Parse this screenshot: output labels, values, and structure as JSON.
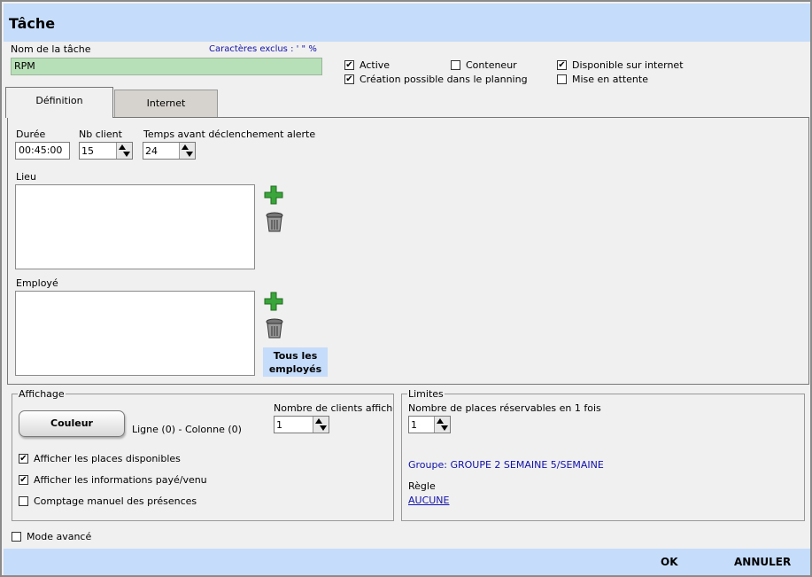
{
  "window": {
    "title": "Tâche"
  },
  "task_name": {
    "label": "Nom de la tâche",
    "excluded_chars_note": "Caractères exclus : ' \" %",
    "value": "RPM"
  },
  "options": {
    "active": {
      "label": "Active",
      "checked": true
    },
    "conteneur": {
      "label": "Conteneur",
      "checked": false
    },
    "disponible_internet": {
      "label": "Disponible sur internet",
      "checked": true
    },
    "creation_planning": {
      "label": "Création possible dans le planning",
      "checked": true
    },
    "mise_en_attente": {
      "label": "Mise en attente",
      "checked": false
    }
  },
  "tabs": [
    {
      "label": "Définition",
      "active": true
    },
    {
      "label": "Internet",
      "active": false
    }
  ],
  "definition": {
    "duree": {
      "label": "Durée",
      "value": "00:45:00"
    },
    "nb_client": {
      "label": "Nb client",
      "value": "15"
    },
    "temps_alerte": {
      "label": "Temps avant déclenchement alerte",
      "value": "24"
    },
    "lieu": {
      "label": "Lieu"
    },
    "employe": {
      "label": "Employé",
      "all_button": "Tous les employés"
    }
  },
  "affichage": {
    "legend": "Affichage",
    "couleur_button": "Couleur",
    "position_text": "Ligne (0) - Colonne (0)",
    "nombre_clients_label": "Nombre de clients affiché",
    "nombre_clients_value": "1",
    "checks": [
      {
        "label": "Afficher les places disponibles",
        "checked": true
      },
      {
        "label": "Afficher les informations payé/venu",
        "checked": true
      },
      {
        "label": "Comptage manuel des présences",
        "checked": false
      }
    ]
  },
  "limites": {
    "legend": "Limites",
    "places_label": "Nombre de places réservables en 1 fois",
    "places_value": "1",
    "groupe_text": "Groupe: GROUPE 2 SEMAINE 5/SEMAINE",
    "regle_label": "Règle",
    "regle_value": "AUCUNE"
  },
  "mode_avance": {
    "label": "Mode avancé",
    "checked": false
  },
  "footer": {
    "ok": "OK",
    "annuler": "ANNULER"
  },
  "colors": {
    "header_blue": "#c5dcfa",
    "name_field_green": "#b8e0b8",
    "link_blue": "#1111aa"
  }
}
